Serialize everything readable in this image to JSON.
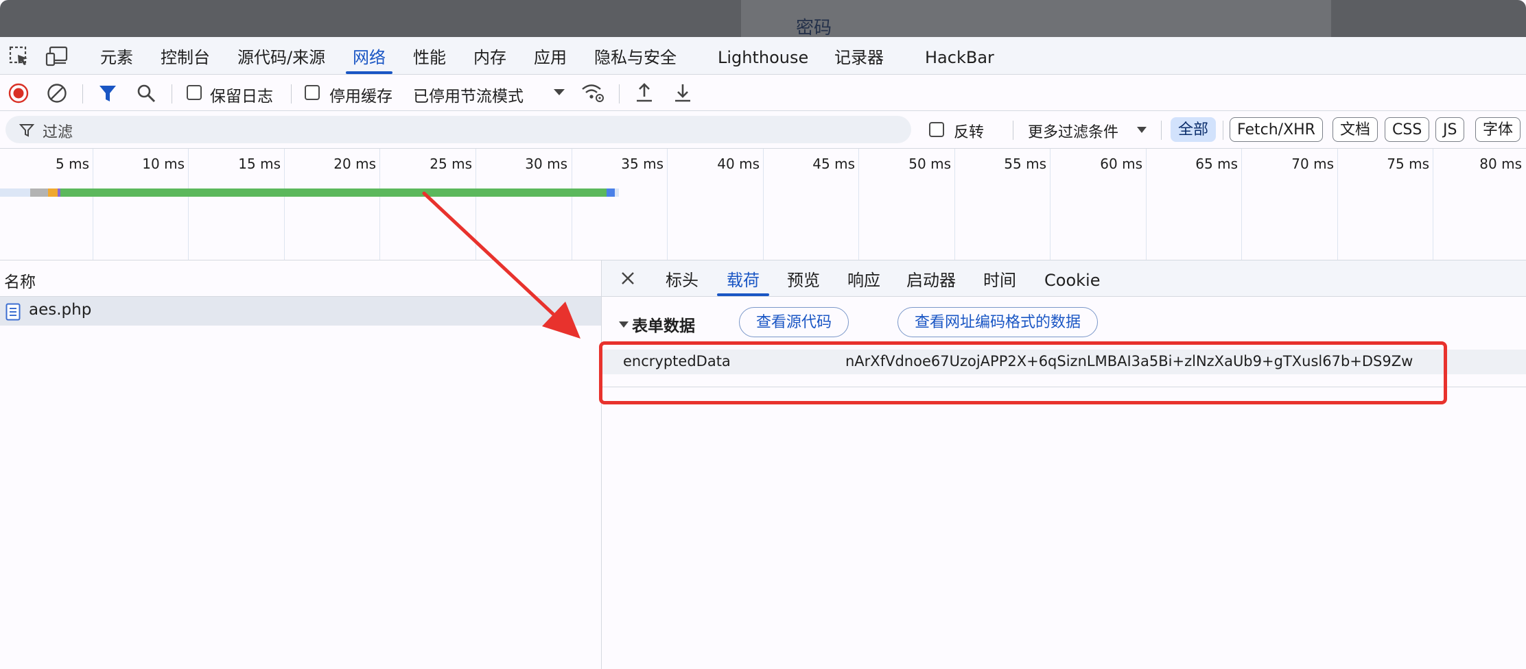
{
  "page_behind": {
    "title": "密码"
  },
  "devtools_tabs": [
    {
      "label": "元素"
    },
    {
      "label": "控制台"
    },
    {
      "label": "源代码/来源"
    },
    {
      "label": "网络"
    },
    {
      "label": "性能"
    },
    {
      "label": "内存"
    },
    {
      "label": "应用"
    },
    {
      "label": "隐私与安全"
    },
    {
      "label": "Lighthouse"
    },
    {
      "label": "记录器"
    },
    {
      "label": "HackBar"
    }
  ],
  "active_tab": "网络",
  "toolbar": {
    "preserve_log": "保留日志",
    "disable_cache": "停用缓存",
    "throttling": "已停用节流模式"
  },
  "filter": {
    "placeholder": "过滤",
    "invert": "反转",
    "more_filters": "更多过滤条件",
    "chips": [
      {
        "label": "全部"
      },
      {
        "label": "Fetch/XHR"
      },
      {
        "label": "文档"
      },
      {
        "label": "CSS"
      },
      {
        "label": "JS"
      },
      {
        "label": "字体"
      }
    ]
  },
  "timeline": {
    "ticks": [
      "5 ms",
      "10 ms",
      "15 ms",
      "20 ms",
      "25 ms",
      "30 ms",
      "35 ms",
      "40 ms",
      "45 ms",
      "50 ms",
      "55 ms",
      "60 ms",
      "65 ms",
      "70 ms",
      "75 ms",
      "80 ms"
    ]
  },
  "request_list": {
    "header": "名称",
    "rows": [
      {
        "name": "aes.php"
      }
    ]
  },
  "detail_tabs": [
    {
      "label": "标头"
    },
    {
      "label": "载荷"
    },
    {
      "label": "预览"
    },
    {
      "label": "响应"
    },
    {
      "label": "启动器"
    },
    {
      "label": "时间"
    },
    {
      "label": "Cookie"
    }
  ],
  "payload": {
    "section_title": "表单数据",
    "view_source": "查看源代码",
    "view_url_encoded": "查看网址编码格式的数据",
    "rows": [
      {
        "key": "encryptedData",
        "value": "nArXfVdnoe67UzojAPP2X+6qSiznLMBAI3a5Bi+zlNzXaUb9+gTXusl67b+DS9Zw"
      }
    ]
  },
  "colors": {
    "accent": "#1a56c4",
    "record_red": "#d93025",
    "annotation_red": "#e8322d",
    "waterfall_green": "#5cb85c"
  }
}
